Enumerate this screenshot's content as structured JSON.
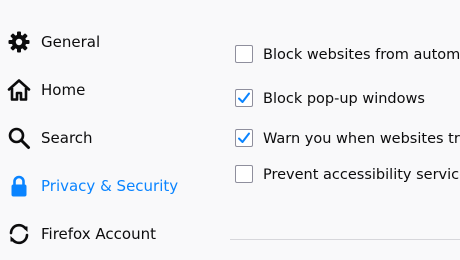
{
  "colors": {
    "background": "#f9f9fa",
    "accent": "#0a84ff",
    "text": "#0c0c0d"
  },
  "sidebar": {
    "items": [
      {
        "label": "General",
        "icon": "gear-icon",
        "selected": false
      },
      {
        "label": "Home",
        "icon": "home-icon",
        "selected": false
      },
      {
        "label": "Search",
        "icon": "search-icon",
        "selected": false
      },
      {
        "label": "Privacy & Security",
        "icon": "lock-icon",
        "selected": true
      },
      {
        "label": "Firefox Account",
        "icon": "sync-icon",
        "selected": false
      }
    ]
  },
  "permissions": {
    "checkboxes": [
      {
        "label": "Block websites from automatically playing sound",
        "checked": false
      },
      {
        "label": "Block pop-up windows",
        "checked": true
      },
      {
        "label": "Warn you when websites try to install add-ons",
        "checked": true
      },
      {
        "label": "Prevent accessibility services from accessing your browser",
        "checked": false
      }
    ]
  }
}
